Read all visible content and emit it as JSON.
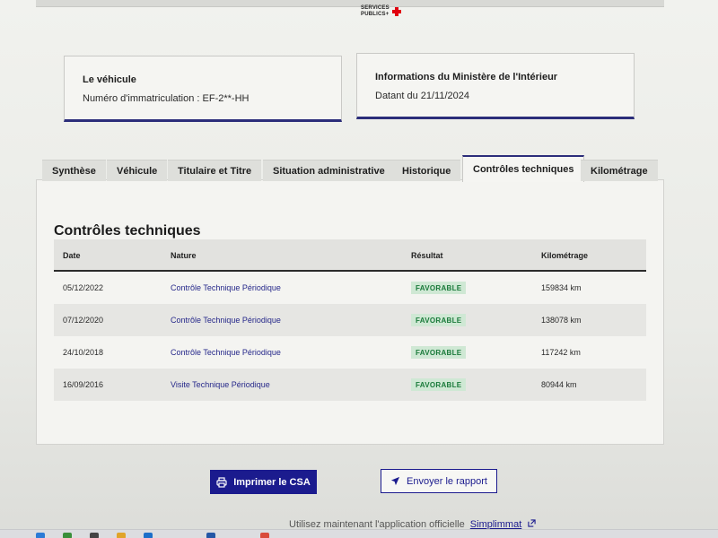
{
  "header": {
    "logo_text": "SERVICES\nPUBLICS+"
  },
  "vehicle_card": {
    "title": "Le véhicule",
    "registration": "Numéro d'immatriculation : EF-2**-HH"
  },
  "ministry_card": {
    "title": "Informations du Ministère de l'Intérieur",
    "date_text": "Datant du 21/11/2024"
  },
  "tabs": [
    {
      "label": "Synthèse",
      "active": false
    },
    {
      "label": "Véhicule",
      "active": false
    },
    {
      "label": "Titulaire et Titre",
      "active": false
    },
    {
      "label": "Situation administrative",
      "active": false
    },
    {
      "label": "Historique",
      "active": false
    },
    {
      "label": "Contrôles techniques",
      "active": true
    },
    {
      "label": "Kilométrage",
      "active": false
    }
  ],
  "panel": {
    "title": "Contrôles techniques"
  },
  "table": {
    "headers": {
      "date": "Date",
      "nature": "Nature",
      "result": "Résultat",
      "mileage": "Kilométrage"
    },
    "rows": [
      {
        "date": "05/12/2022",
        "nature": "Contrôle Technique Périodique",
        "result": "FAVORABLE",
        "mileage": "159834 km"
      },
      {
        "date": "07/12/2020",
        "nature": "Contrôle Technique Périodique",
        "result": "FAVORABLE",
        "mileage": "138078 km"
      },
      {
        "date": "24/10/2018",
        "nature": "Contrôle Technique Périodique",
        "result": "FAVORABLE",
        "mileage": "117242 km"
      },
      {
        "date": "16/09/2016",
        "nature": "Visite Technique Périodique",
        "result": "FAVORABLE",
        "mileage": "80944 km"
      }
    ]
  },
  "actions": {
    "print_label": "Imprimer le CSA",
    "send_label": "Envoyer le rapport"
  },
  "footer": {
    "text": "Utilisez maintenant l'application officielle",
    "link": "Simplimmat"
  },
  "colors": {
    "primary": "#1b1b8e",
    "success_bg": "#cfe8d4",
    "success_text": "#1a7a3a",
    "marianne_red": "#e1000f"
  },
  "icons": {
    "print": "printer-icon",
    "send": "paper-plane-icon",
    "external_link": "external-link-icon"
  }
}
